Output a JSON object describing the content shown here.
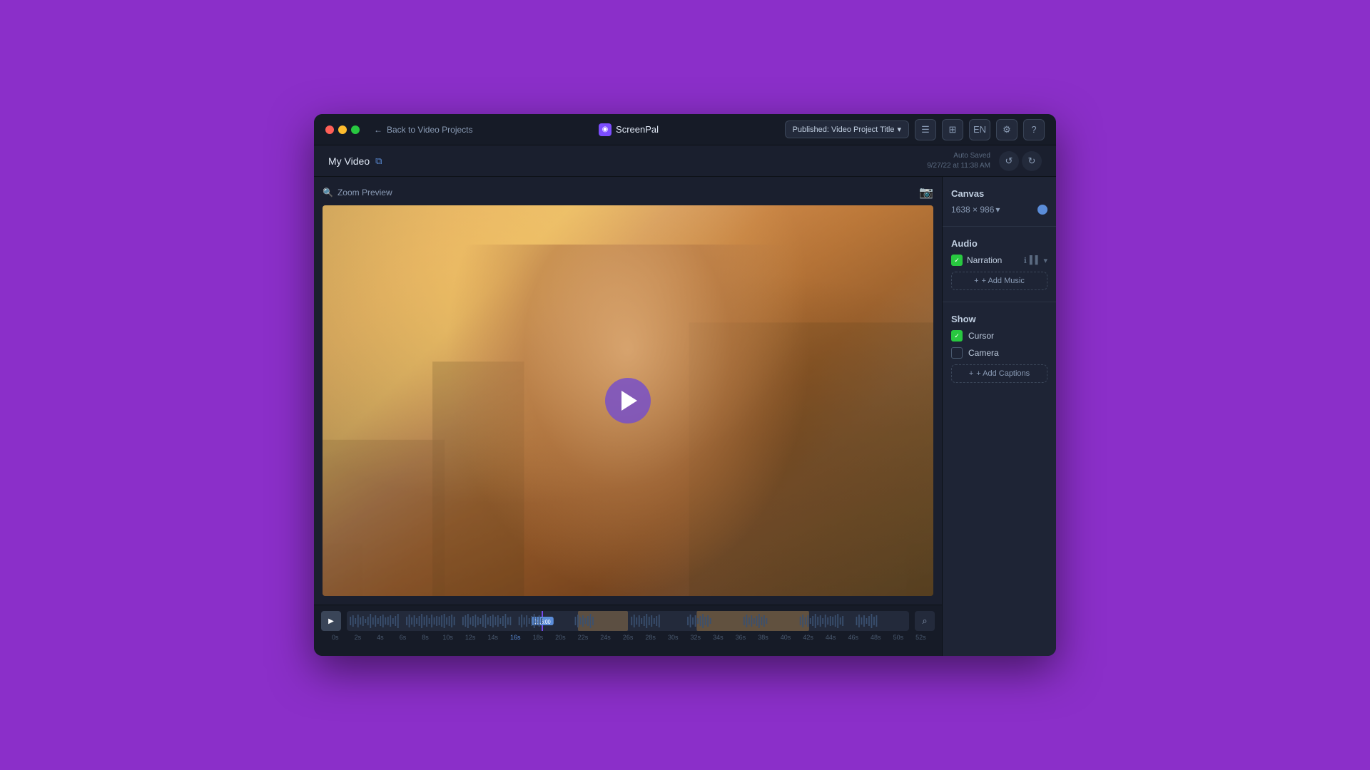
{
  "app": {
    "name": "ScreenPal",
    "logo_symbol": "◉"
  },
  "titlebar": {
    "back_label": "Back to Video Projects",
    "publish_label": "Published: Video Project Title",
    "lang_label": "EN",
    "traffic_lights": [
      "red",
      "yellow",
      "green"
    ]
  },
  "subheader": {
    "video_title": "My Video",
    "auto_saved_label": "Auto Saved",
    "auto_saved_date": "9/27/22 at 11:38 AM"
  },
  "preview": {
    "zoom_preview_label": "Zoom Preview"
  },
  "timeline": {
    "current_time": "0:16:00",
    "timecodes": [
      "0s",
      "2s",
      "4s",
      "6s",
      "8s",
      "10s",
      "12s",
      "14s",
      "16s",
      "18s",
      "20s",
      "22s",
      "24s",
      "26s",
      "28s",
      "30s",
      "32s",
      "34s",
      "36s",
      "38s",
      "40s",
      "42s",
      "44s",
      "46s",
      "48s",
      "50s",
      "52s"
    ]
  },
  "right_panel": {
    "canvas": {
      "title": "Canvas",
      "size": "1638 × 986"
    },
    "audio": {
      "title": "Audio",
      "narration_label": "Narration",
      "add_music_label": "+ Add Music"
    },
    "show": {
      "title": "Show",
      "cursor_label": "Cursor",
      "camera_label": "Camera",
      "add_captions_label": "+ Add Captions"
    }
  },
  "icons": {
    "back_arrow": "←",
    "search": "🔍",
    "camera": "📷",
    "play": "▶",
    "undo": "↺",
    "redo": "↻",
    "external_link": "⧉",
    "chevron_down": "▾",
    "info": "ℹ",
    "bars": "▌▌▌",
    "plus": "+",
    "check": "✓",
    "magnify": "⌕",
    "grid": "⊞",
    "list": "☰",
    "settings": "⚙",
    "question": "?"
  }
}
